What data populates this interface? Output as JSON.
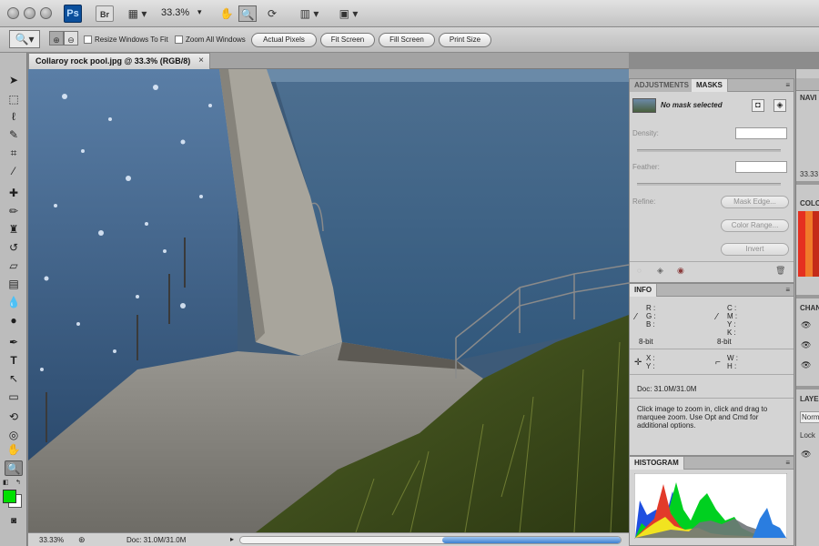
{
  "app": {
    "logo_text": "Ps",
    "bridge_label": "Br",
    "zoom_value": "33.3%"
  },
  "options_bar": {
    "resize_windows": "Resize Windows To Fit",
    "zoom_all_windows": "Zoom All Windows",
    "buttons": [
      "Actual Pixels",
      "Fit Screen",
      "Fill Screen",
      "Print Size"
    ]
  },
  "document": {
    "tab_title": "Collaroy rock pool.jpg @ 33.3% (RGB/8)",
    "close_glyph": "×"
  },
  "status": {
    "zoom": "33.33%",
    "doc": "Doc: 31.0M/31.0M"
  },
  "adjustments_panel": {
    "tabs": [
      "ADJUSTMENTS",
      "MASKS"
    ],
    "mask_status": "No mask selected",
    "density_label": "Density:",
    "feather_label": "Feather:",
    "refine_label": "Refine:",
    "buttons": [
      "Mask Edge...",
      "Color Range...",
      "Invert"
    ]
  },
  "info_panel": {
    "tab": "INFO",
    "rgb": [
      "R :",
      "G :",
      "B :"
    ],
    "cmyk": [
      "C :",
      "M :",
      "Y :",
      "K :"
    ],
    "bit_left": "8-bit",
    "bit_right": "8-bit",
    "xy": [
      "X :",
      "Y :"
    ],
    "wh": [
      "W :",
      "H :"
    ],
    "doc": "Doc: 31.0M/31.0M",
    "hint": "Click image to zoom in, click and drag to marquee zoom.  Use Opt and Cmd for additional options."
  },
  "histogram_panel": {
    "tab": "HISTOGRAM"
  },
  "dock": {
    "navigator": "NAVI",
    "nav_zoom": "33.33",
    "color": "COLO",
    "channels": "CHAN",
    "layers": "LAYE",
    "blend": "Norm",
    "lock": "Lock"
  },
  "colors": {
    "foreground": "#00e000",
    "background": "#ffffff",
    "accent": "#0b4f9c"
  }
}
